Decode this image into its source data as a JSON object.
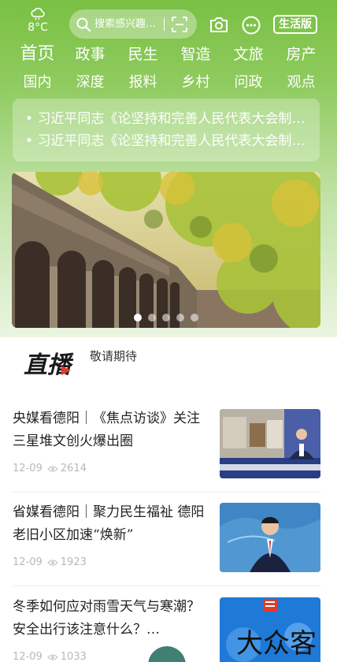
{
  "header": {
    "weather": {
      "icon": "cloud-icon",
      "temperature": "8°C"
    },
    "search": {
      "placeholder": "搜索感兴趣的内容"
    },
    "life_label": "生活版"
  },
  "nav": {
    "row1": [
      "首页",
      "政事",
      "民生",
      "智造",
      "文旅",
      "房产"
    ],
    "row2": [
      "国内",
      "深度",
      "报料",
      "乡村",
      "问政",
      "观点"
    ]
  },
  "headlines": [
    "习近平同志《论坚持和完善人民代表大会制度》主要篇目介绍",
    "习近平同志《论坚持和完善人民代表大会制度》出版发行"
  ],
  "banner": {
    "slide_count": 5,
    "active_index": 0
  },
  "live": {
    "logo_text": "直播",
    "status": "敬请期待"
  },
  "news": [
    {
      "title": "央媒看德阳｜《焦点访谈》关注三星堆文创火爆出圈",
      "date": "12-09",
      "views": "2614"
    },
    {
      "title": "省媒看德阳｜聚力民生福祉 德阳老旧小区加速“焕新”",
      "date": "12-09",
      "views": "1923"
    },
    {
      "title": "冬季如何应对雨雪天气与寒潮？安全出行该注意什么？…",
      "date": "12-09",
      "views": "1033"
    }
  ],
  "watermark": "大众客",
  "colors": {
    "brand_green": "#79c043",
    "meta_gray": "#b8b8b8"
  }
}
